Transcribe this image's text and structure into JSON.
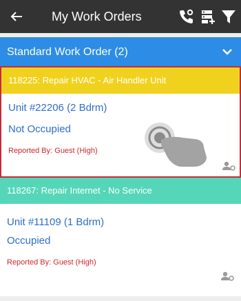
{
  "header": {
    "title": "My Work Orders",
    "back_icon": "arrow-left-icon",
    "icons": [
      "phone-settings-icon",
      "server-add-icon",
      "filter-icon"
    ]
  },
  "group": {
    "label": "Standard Work Order (2)",
    "expand_icon": "chevron-down-icon"
  },
  "work_orders": [
    {
      "header": "118225: Repair HVAC - Air Handler Unit",
      "header_color": "#f0d21e",
      "unit": "Unit #22206 (2 Bdrm)",
      "occupancy": "Not Occupied",
      "reported": "Reported By: Guest  (High)",
      "selected": true
    },
    {
      "header": "118267: Repair Internet - No Service",
      "header_color": "#55d6b8",
      "unit": "Unit #11109 (1 Bdrm)",
      "occupancy": "Occupied",
      "reported": "Reported By: Guest  (High)",
      "selected": false
    }
  ],
  "colors": {
    "topbar": "#333333",
    "group_header": "#2d8ce6",
    "link_text": "#2d6ec8",
    "priority_text": "#d0262e",
    "selected_border": "#c62b3a"
  }
}
